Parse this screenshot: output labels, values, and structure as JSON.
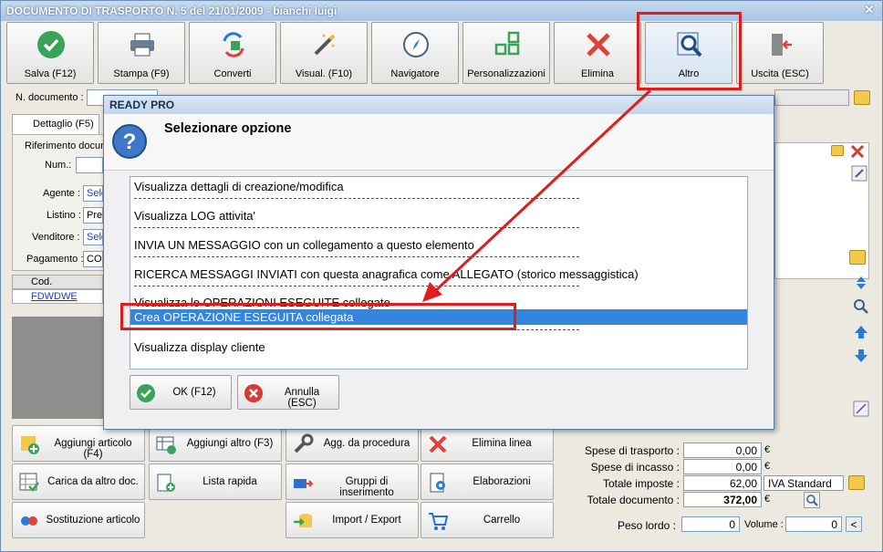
{
  "window": {
    "title": "DOCUMENTO DI TRASPORTO N. 5 del 21/01/2009 - bianchi luigi"
  },
  "toolbar": {
    "buttons": [
      {
        "label": "Salva (F12)",
        "icon": "check-icon"
      },
      {
        "label": "Stampa (F9)",
        "icon": "printer-icon"
      },
      {
        "label": "Converti",
        "icon": "convert-icon"
      },
      {
        "label": "Visual. (F10)",
        "icon": "magic-wand-icon"
      },
      {
        "label": "Navigatore",
        "icon": "compass-icon"
      },
      {
        "label": "Personalizzazioni",
        "icon": "grid-icon"
      },
      {
        "label": "Elimina",
        "icon": "x-icon"
      },
      {
        "label": "Altro",
        "icon": "magnifier-icon"
      },
      {
        "label": "Uscita (ESC)",
        "icon": "exit-icon"
      }
    ]
  },
  "form": {
    "n_documento_label": "N. documento :",
    "tab_label": "Dettaglio (F5)",
    "riferimento_label": "Riferimento docum",
    "num_label": "Num.:",
    "agente_label": "Agente :",
    "agente_value": "Sele",
    "listino_label": "Listino :",
    "listino_value": "Pre",
    "venditore_label": "Venditore :",
    "venditore_value": "Sele",
    "pagamento_label": "Pagamento :",
    "pagamento_value": "CO"
  },
  "grid": {
    "header": "Cod.",
    "rows": [
      "FDWDWE"
    ]
  },
  "bottom_buttons": [
    {
      "label": "Aggiungi articolo (F4)",
      "icon": "add-article-icon"
    },
    {
      "label": "Aggiungi altro (F3)",
      "icon": "add-other-icon"
    },
    {
      "label": "Agg. da procedura",
      "icon": "wrench-icon"
    },
    {
      "label": "Elimina linea",
      "icon": "x-icon"
    },
    {
      "label": "Carica da altro doc.",
      "icon": "load-doc-icon"
    },
    {
      "label": "Lista rapida",
      "icon": "quick-list-icon"
    },
    {
      "label": "Gruppi di inserimento",
      "icon": "groups-icon"
    },
    {
      "label": "Elaborazioni",
      "icon": "gear-doc-icon"
    },
    {
      "label": "Sostituzione articolo",
      "icon": "replace-icon"
    },
    {
      "label": "Import / Export",
      "icon": "import-export-icon"
    },
    {
      "label": "Carrello",
      "icon": "cart-icon"
    }
  ],
  "totals": {
    "spese_trasporto_label": "Spese di trasporto :",
    "spese_trasporto_value": "0,00",
    "spese_incasso_label": "Spese di incasso :",
    "spese_incasso_value": "0,00",
    "totale_imposte_label": "Totale imposte :",
    "totale_imposte_value": "62,00",
    "iva_label": "IVA Standard",
    "totale_documento_label": "Totale documento :",
    "totale_documento_value": "372,00",
    "currency": "€",
    "peso_lordo_label": "Peso lordo :",
    "peso_lordo_value": "0",
    "volume_label": "Volume :",
    "volume_value": "0",
    "lt_label": "<"
  },
  "dialog": {
    "app_title": "READY PRO",
    "heading": "Selezionare opzione",
    "options": [
      "Visualizza dettagli di creazione/modifica",
      "Visualizza LOG attivita'",
      "INVIA UN MESSAGGIO con un collegamento a questo elemento",
      "RICERCA MESSAGGI INVIATI con questa anagrafica come ALLEGATO (storico messaggistica)",
      "Visualizza le OPERAZIONI ESEGUITE collegate",
      "Crea OPERAZIONE ESEGUITA collegata",
      "Visualizza display cliente"
    ],
    "selected_index": 5,
    "ok_label": "OK (F12)",
    "cancel_label": "Annulla (ESC)"
  },
  "colors": {
    "highlight": "#e01c1c",
    "selection": "#3385dd"
  }
}
